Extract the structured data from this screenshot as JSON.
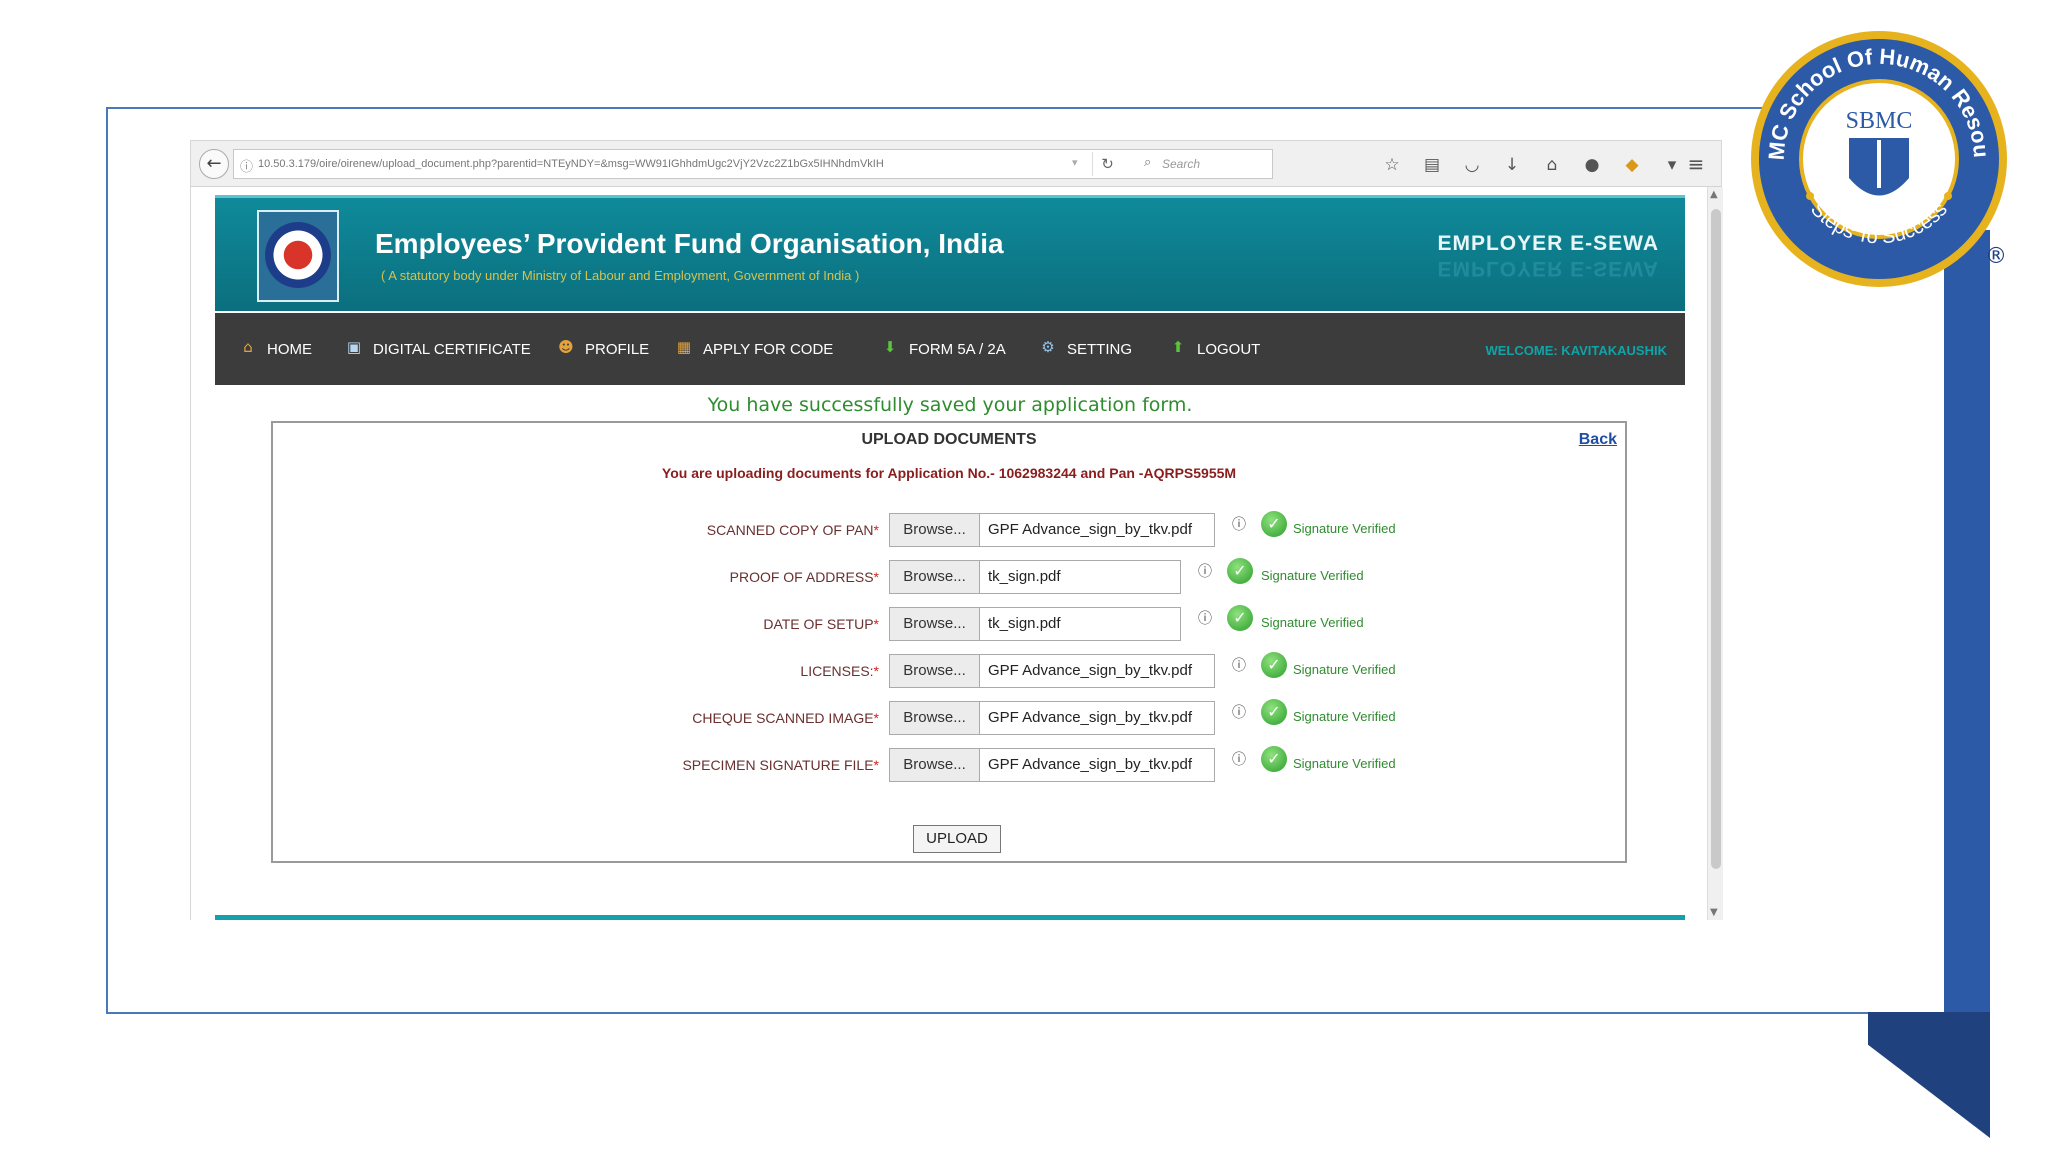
{
  "browser": {
    "url": "10.50.3.179/oire/oirenew/upload_document.php?parentid=NTEyNDY=&msg=WW91IGhhdmUgc2VjY2Vzc2Z1bGx5IHNhdmVkIH",
    "search_placeholder": "Search",
    "toolbar_icons": [
      "star-icon",
      "clipboard-icon",
      "pocket-icon",
      "download-icon",
      "home-icon",
      "chat-icon",
      "extension-icon",
      "dropdown-icon"
    ]
  },
  "header": {
    "org_title": "Employees’ Provident Fund Organisation, India",
    "org_subtitle": "( A statutory body under Ministry of Labour and Employment, Government of India )",
    "service_name": "EMPLOYER E-SEWA"
  },
  "nav": {
    "items": [
      {
        "label": "HOME",
        "icon": "home-icon"
      },
      {
        "label": "DIGITAL CERTIFICATE",
        "icon": "certificate-icon"
      },
      {
        "label": "PROFILE",
        "icon": "profile-icon"
      },
      {
        "label": "APPLY FOR CODE",
        "icon": "apply-icon"
      },
      {
        "label": "FORM 5A / 2A",
        "icon": "download-arrow-icon"
      },
      {
        "label": "SETTING",
        "icon": "settings-icon"
      },
      {
        "label": "LOGOUT",
        "icon": "logout-arrow-icon"
      }
    ],
    "welcome": "WELCOME: KAVITAKAUSHIK"
  },
  "main": {
    "success_message": "You have successfully saved your application form.",
    "panel_title": "UPLOAD DOCUMENTS",
    "back_label": "Back",
    "application_info": "You are uploading documents for Application No.- 1062983244 and Pan -AQRPS5955M",
    "documents": [
      {
        "label": "SCANNED COPY OF PAN",
        "browse": "Browse...",
        "file": "GPF Advance_sign_by_tkv.pdf",
        "status": "Signature Verified"
      },
      {
        "label": "PROOF OF ADDRESS",
        "browse": "Browse...",
        "file": "tk_sign.pdf",
        "status": "Signature Verified"
      },
      {
        "label": "DATE OF SETUP",
        "browse": "Browse...",
        "file": "tk_sign.pdf",
        "status": "Signature Verified"
      },
      {
        "label": "LICENSES:",
        "browse": "Browse...",
        "file": "GPF Advance_sign_by_tkv.pdf",
        "status": "Signature Verified"
      },
      {
        "label": "CHEQUE SCANNED IMAGE",
        "browse": "Browse...",
        "file": "GPF Advance_sign_by_tkv.pdf",
        "status": "Signature Verified"
      },
      {
        "label": "SPECIMEN SIGNATURE FILE",
        "browse": "Browse...",
        "file": "GPF Advance_sign_by_tkv.pdf",
        "status": "Signature Verified"
      }
    ],
    "upload_label": "UPLOAD"
  },
  "badge": {
    "ring_text": "SBMC School Of Human Resource",
    "center_text": "SBMC",
    "tagline": "Steps To Success",
    "registered": "®"
  },
  "colors": {
    "header_teal": "#0f8a9a",
    "nav_dark": "#3c3c3c",
    "success_green": "#2f8c2f",
    "badge_gold": "#e0b21e",
    "badge_blue": "#2d5aa6"
  }
}
